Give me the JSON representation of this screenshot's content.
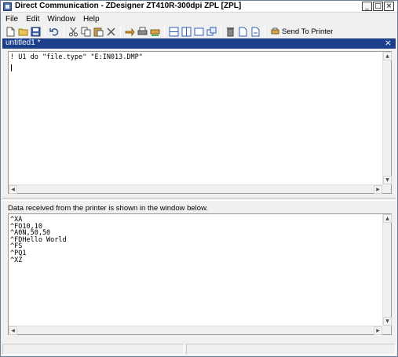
{
  "window": {
    "title": "Direct Communication - ZDesigner ZT410R-300dpi ZPL [ZPL]",
    "controls": [
      "_",
      "□",
      "×"
    ]
  },
  "menu": [
    "File",
    "Edit",
    "Window",
    "Help"
  ],
  "toolbar": {
    "send_label": "Send To Printer"
  },
  "document": {
    "tab_title": "untitled1 *",
    "close_glyph": "×",
    "editor_text": "! U1 do \"file.type\" \"E:IN013.DMP\""
  },
  "output": {
    "info_label": "Data received from the printer is shown in the window below.",
    "lines": [
      "^XA",
      "^FO10,10",
      "^A0N,50,50",
      "^FDHello World",
      "^FS",
      "^PQ1",
      "^XZ"
    ]
  },
  "scroll_glyphs": {
    "up": "▲",
    "down": "▼",
    "left": "◀",
    "right": "▶"
  },
  "colors": {
    "doc_tab_bg": "#1c3f8c",
    "window_bg": "#f0f0f0"
  }
}
